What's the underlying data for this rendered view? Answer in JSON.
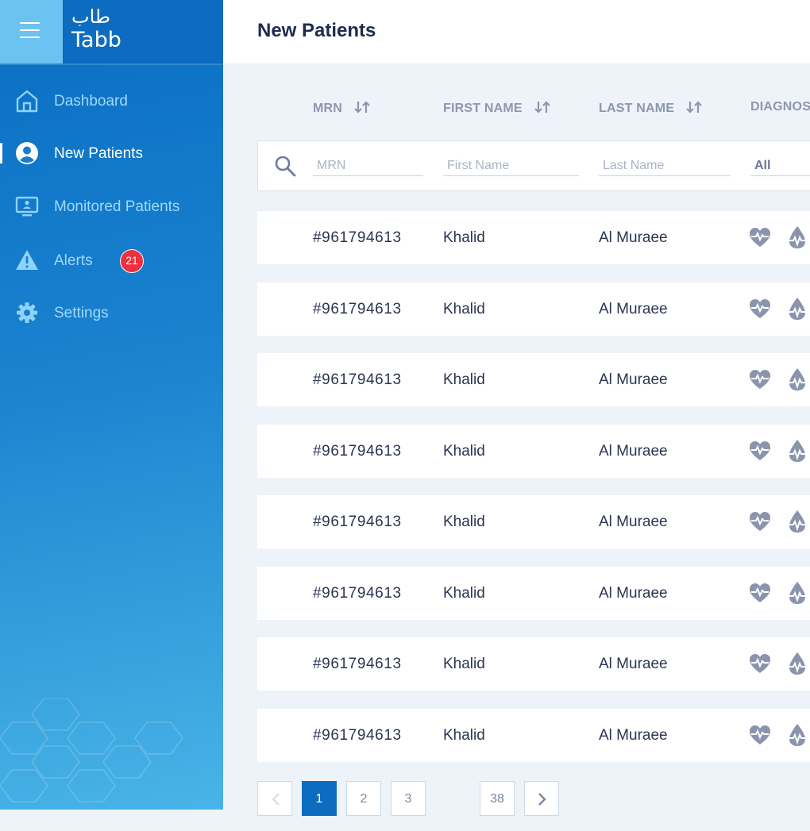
{
  "app": {
    "logo_arabic": "طاب",
    "logo_latin": "Tabb"
  },
  "sidebar": {
    "items": [
      {
        "label": "Dashboard",
        "icon": "home-icon"
      },
      {
        "label": "New Patients",
        "icon": "user-circle-icon",
        "active": true
      },
      {
        "label": "Monitored Patients",
        "icon": "monitor-icon"
      },
      {
        "label": "Alerts",
        "icon": "warning-icon",
        "badge": "21"
      },
      {
        "label": "Settings",
        "icon": "gear-icon"
      }
    ]
  },
  "header": {
    "title": "New Patients"
  },
  "table": {
    "columns": [
      "MRN",
      "FIRST NAME",
      "LAST NAME",
      "DIAGNOS"
    ],
    "filters": {
      "mrn_placeholder": "MRN",
      "first_name_placeholder": "First Name",
      "last_name_placeholder": "Last Name",
      "diagnosis_selected": "All"
    },
    "rows": [
      {
        "mrn": "#961794613",
        "first_name": "Khalid",
        "last_name": "Al Muraee",
        "diagnosis_icons": [
          "heart-pulse-icon",
          "drop-pulse-icon"
        ]
      },
      {
        "mrn": "#961794613",
        "first_name": "Khalid",
        "last_name": "Al Muraee",
        "diagnosis_icons": [
          "heart-pulse-icon",
          "drop-pulse-icon"
        ]
      },
      {
        "mrn": "#961794613",
        "first_name": "Khalid",
        "last_name": "Al Muraee",
        "diagnosis_icons": [
          "heart-pulse-icon",
          "drop-pulse-icon"
        ]
      },
      {
        "mrn": "#961794613",
        "first_name": "Khalid",
        "last_name": "Al Muraee",
        "diagnosis_icons": [
          "heart-pulse-icon",
          "drop-pulse-icon"
        ]
      },
      {
        "mrn": "#961794613",
        "first_name": "Khalid",
        "last_name": "Al Muraee",
        "diagnosis_icons": [
          "heart-pulse-icon",
          "drop-pulse-icon"
        ]
      },
      {
        "mrn": "#961794613",
        "first_name": "Khalid",
        "last_name": "Al Muraee",
        "diagnosis_icons": [
          "heart-pulse-icon",
          "drop-pulse-icon"
        ]
      },
      {
        "mrn": "#961794613",
        "first_name": "Khalid",
        "last_name": "Al Muraee",
        "diagnosis_icons": [
          "heart-pulse-icon",
          "drop-pulse-icon"
        ]
      },
      {
        "mrn": "#961794613",
        "first_name": "Khalid",
        "last_name": "Al Muraee",
        "diagnosis_icons": [
          "heart-pulse-icon",
          "drop-pulse-icon"
        ]
      }
    ]
  },
  "pagination": {
    "pages": [
      "1",
      "2",
      "3",
      "38"
    ],
    "current": "1"
  },
  "colors": {
    "sidebar_top": "#0d6cbf",
    "accent_light": "#6cc2f0",
    "nav_text": "#9fd9fb",
    "badge": "#ee2f3f",
    "title": "#1d2b4f"
  }
}
